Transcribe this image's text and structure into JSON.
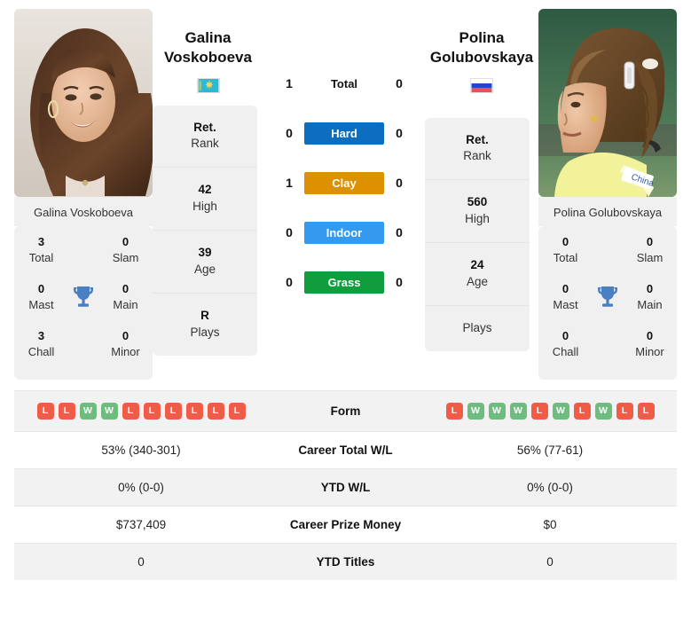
{
  "players": {
    "left": {
      "first_name": "Galina",
      "last_name": "Voskoboeva",
      "full_name": "Galina Voskoboeva",
      "country": "Kazakhstan",
      "flag_colors": {
        "field": "#2eb8d4",
        "emblem": "#ffd24d"
      },
      "titles": {
        "total_value": "3",
        "total_label": "Total",
        "slam_value": "0",
        "slam_label": "Slam",
        "mast_value": "0",
        "mast_label": "Mast",
        "main_value": "0",
        "main_label": "Main",
        "chall_value": "3",
        "chall_label": "Chall",
        "minor_value": "0",
        "minor_label": "Minor"
      },
      "ranking": [
        {
          "value": "Ret.",
          "label": "Rank"
        },
        {
          "value": "42",
          "label": "High"
        },
        {
          "value": "39",
          "label": "Age"
        },
        {
          "value": "R",
          "label": "Plays"
        }
      ],
      "form": [
        "L",
        "L",
        "W",
        "W",
        "L",
        "L",
        "L",
        "L",
        "L",
        "L"
      ],
      "career_total_wl": "53% (340-301)",
      "ytd_wl": "0% (0-0)",
      "career_prize_money": "$737,409",
      "ytd_titles": "0"
    },
    "right": {
      "first_name": "Polina",
      "last_name": "Golubovskaya",
      "full_name": "Polina Golubovskaya",
      "country": "Russia",
      "flag_colors": {
        "white": "#ffffff",
        "blue": "#2347c6",
        "red": "#e8505b"
      },
      "titles": {
        "total_value": "0",
        "total_label": "Total",
        "slam_value": "0",
        "slam_label": "Slam",
        "mast_value": "0",
        "mast_label": "Mast",
        "main_value": "0",
        "main_label": "Main",
        "chall_value": "0",
        "chall_label": "Chall",
        "minor_value": "0",
        "minor_label": "Minor"
      },
      "ranking": [
        {
          "value": "Ret.",
          "label": "Rank"
        },
        {
          "value": "560",
          "label": "High"
        },
        {
          "value": "24",
          "label": "Age"
        },
        {
          "value": "",
          "label": "Plays"
        }
      ],
      "form": [
        "L",
        "W",
        "W",
        "W",
        "L",
        "W",
        "L",
        "W",
        "L",
        "L"
      ],
      "career_total_wl": "56% (77-61)",
      "ytd_wl": "0% (0-0)",
      "career_prize_money": "$0",
      "ytd_titles": "0"
    }
  },
  "head_to_head": [
    {
      "label": "Total",
      "left": "1",
      "right": "0",
      "color": "transparent",
      "text_color": "#111111"
    },
    {
      "label": "Hard",
      "left": "0",
      "right": "0",
      "color": "#0d6ec0",
      "text_color": "#ffffff"
    },
    {
      "label": "Clay",
      "left": "1",
      "right": "0",
      "color": "#dd9000",
      "text_color": "#ffffff"
    },
    {
      "label": "Indoor",
      "left": "0",
      "right": "0",
      "color": "#339af0",
      "text_color": "#ffffff"
    },
    {
      "label": "Grass",
      "left": "0",
      "right": "0",
      "color": "#0f9d3d",
      "text_color": "#ffffff"
    }
  ],
  "comparison_rows": [
    {
      "label": "Form",
      "type": "form"
    },
    {
      "label": "Career Total W/L",
      "type": "text",
      "left": "53% (340-301)",
      "right": "56% (77-61)"
    },
    {
      "label": "YTD W/L",
      "type": "text",
      "left": "0% (0-0)",
      "right": "0% (0-0)"
    },
    {
      "label": "Career Prize Money",
      "type": "text",
      "left": "$737,409",
      "right": "$0"
    },
    {
      "label": "YTD Titles",
      "type": "text",
      "left": "0",
      "right": "0"
    }
  ]
}
